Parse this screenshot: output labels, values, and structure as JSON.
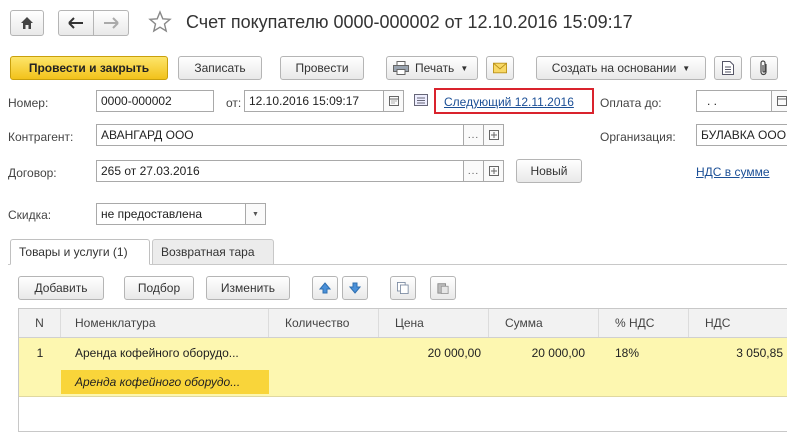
{
  "header": {
    "title": "Счет покупателю 0000-000002 от 12.10.2016 15:09:17"
  },
  "toolbar": {
    "post_and_close": "Провести и закрыть",
    "save": "Записать",
    "post": "Провести",
    "print": "Печать",
    "create_based_on": "Создать на основании"
  },
  "form": {
    "number_label": "Номер:",
    "number_value": "0000-000002",
    "date_prefix": "от:",
    "date_value": "12.10.2016 15:09:17",
    "next_link": "Следующий 12.11.2016",
    "payment_due_label": "Оплата до:",
    "payment_due_value": ".   .",
    "counterparty_label": "Контрагент:",
    "counterparty_value": "АВАНГАРД ООО",
    "organization_label": "Организация:",
    "organization_value": "БУЛАВКА ООО",
    "contract_label": "Договор:",
    "contract_value": "265 от 27.03.2016",
    "new_button": "Новый",
    "vat_link": "НДС в сумме",
    "discount_label": "Скидка:",
    "discount_value": "не предоставлена"
  },
  "tabs": [
    {
      "label": "Товары и услуги (1)",
      "active": true
    },
    {
      "label": "Возвратная тара",
      "active": false
    }
  ],
  "table_toolbar": {
    "add": "Добавить",
    "select": "Подбор",
    "edit": "Изменить"
  },
  "table": {
    "columns": [
      "N",
      "Номенклатура",
      "Количество",
      "Цена",
      "Сумма",
      "% НДС",
      "НДС"
    ],
    "rows": [
      {
        "n": "1",
        "item": "Аренда кофейного оборудо...",
        "item_sub": "Аренда кофейного оборудо...",
        "qty": "",
        "price": "20 000,00",
        "sum": "20 000,00",
        "vat_rate": "18%",
        "vat": "3 050,85"
      }
    ]
  },
  "colors": {
    "accent_yellow": "#f5c518",
    "row_highlight": "#fdf7b0",
    "row_sub_highlight": "#f9d53a",
    "link": "#1b4f96",
    "annotation_red": "#d9232d"
  }
}
